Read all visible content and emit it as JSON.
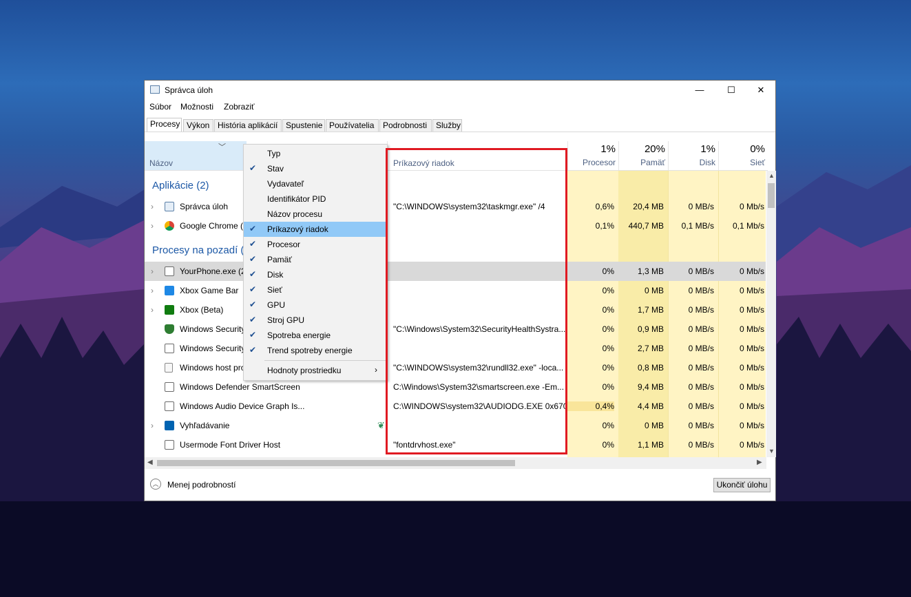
{
  "window": {
    "title": "Správca úloh",
    "controls": {
      "minimize": "—",
      "maximize": "☐",
      "close": "✕"
    }
  },
  "menubar": [
    "Súbor",
    "Možnosti",
    "Zobraziť"
  ],
  "tabs": [
    "Procesy",
    "Výkon",
    "História aplikácií",
    "Spustenie",
    "Používatelia",
    "Podrobnosti",
    "Služby"
  ],
  "columns": {
    "name_label": "Názov",
    "command_label": "Príkazový riadok",
    "cpu": {
      "pct": "1%",
      "label": "Procesor"
    },
    "mem": {
      "pct": "20%",
      "label": "Pamäť"
    },
    "disk": {
      "pct": "1%",
      "label": "Disk"
    },
    "net": {
      "pct": "0%",
      "label": "Sieť"
    }
  },
  "groups": {
    "apps": "Aplikácie (2)",
    "background": "Procesy na pozadí ("
  },
  "processes": [
    {
      "name": "Správca úloh",
      "cmd": "\"C:\\WINDOWS\\system32\\taskmgr.exe\" /4",
      "cpu": "0,6%",
      "mem": "20,4 MB",
      "disk": "0 MB/s",
      "net": "0 Mb/s"
    },
    {
      "name": "Google Chrome (9",
      "cmd": "",
      "cpu": "0,1%",
      "mem": "440,7 MB",
      "disk": "0,1 MB/s",
      "net": "0,1 Mb/s"
    },
    {
      "name": "YourPhone.exe (2",
      "cmd": "",
      "cpu": "0%",
      "mem": "1,3 MB",
      "disk": "0 MB/s",
      "net": "0 Mb/s"
    },
    {
      "name": "Xbox Game Bar",
      "cmd": "",
      "cpu": "0%",
      "mem": "0 MB",
      "disk": "0 MB/s",
      "net": "0 Mb/s"
    },
    {
      "name": "Xbox (Beta)",
      "cmd": "",
      "cpu": "0%",
      "mem": "1,7 MB",
      "disk": "0 MB/s",
      "net": "0 Mb/s"
    },
    {
      "name": "Windows Security",
      "cmd": "\"C:\\Windows\\System32\\SecurityHealthSystra...",
      "cpu": "0%",
      "mem": "0,9 MB",
      "disk": "0 MB/s",
      "net": "0 Mb/s"
    },
    {
      "name": "Windows Security",
      "cmd": "",
      "cpu": "0%",
      "mem": "2,7 MB",
      "disk": "0 MB/s",
      "net": "0 Mb/s"
    },
    {
      "name": "Windows host pro",
      "cmd": "\"C:\\WINDOWS\\system32\\rundll32.exe\" -loca...",
      "cpu": "0%",
      "mem": "0,8 MB",
      "disk": "0 MB/s",
      "net": "0 Mb/s"
    },
    {
      "name": "Windows Defender SmartScreen",
      "cmd": "C:\\Windows\\System32\\smartscreen.exe -Em...",
      "cpu": "0%",
      "mem": "9,4 MB",
      "disk": "0 MB/s",
      "net": "0 Mb/s"
    },
    {
      "name": "Windows Audio Device Graph Is...",
      "cmd": "C:\\WINDOWS\\system32\\AUDIODG.EXE 0x670",
      "cpu": "0,4%",
      "mem": "4,4 MB",
      "disk": "0 MB/s",
      "net": "0 Mb/s"
    },
    {
      "name": "Vyhľadávanie",
      "cmd": "",
      "cpu": "0%",
      "mem": "0 MB",
      "disk": "0 MB/s",
      "net": "0 Mb/s"
    },
    {
      "name": "Usermode Font Driver Host",
      "cmd": "\"fontdrvhost.exe\"",
      "cpu": "0%",
      "mem": "1,1 MB",
      "disk": "0 MB/s",
      "net": "0 Mb/s"
    }
  ],
  "context_menu": [
    {
      "label": "Typ",
      "checked": false
    },
    {
      "label": "Stav",
      "checked": true
    },
    {
      "label": "Vydavateľ",
      "checked": false
    },
    {
      "label": "Identifikátor PID",
      "checked": false
    },
    {
      "label": "Názov procesu",
      "checked": false
    },
    {
      "label": "Príkazový riadok",
      "checked": true
    },
    {
      "label": "Procesor",
      "checked": true
    },
    {
      "label": "Pamäť",
      "checked": true
    },
    {
      "label": "Disk",
      "checked": true
    },
    {
      "label": "Sieť",
      "checked": true
    },
    {
      "label": "GPU",
      "checked": true
    },
    {
      "label": "Stroj GPU",
      "checked": true
    },
    {
      "label": "Spotreba energie",
      "checked": true
    },
    {
      "label": "Trend spotreby energie",
      "checked": true
    },
    {
      "label": "Hodnoty prostriedku",
      "checked": false
    }
  ],
  "footer": {
    "less_details": "Menej podrobností",
    "end_task": "Ukončiť úlohu"
  },
  "colors": {
    "heat_light": "#fff4c4",
    "heat_mid": "#f9eca8",
    "highlight": "#e60000",
    "accent": "#1c58a6"
  }
}
